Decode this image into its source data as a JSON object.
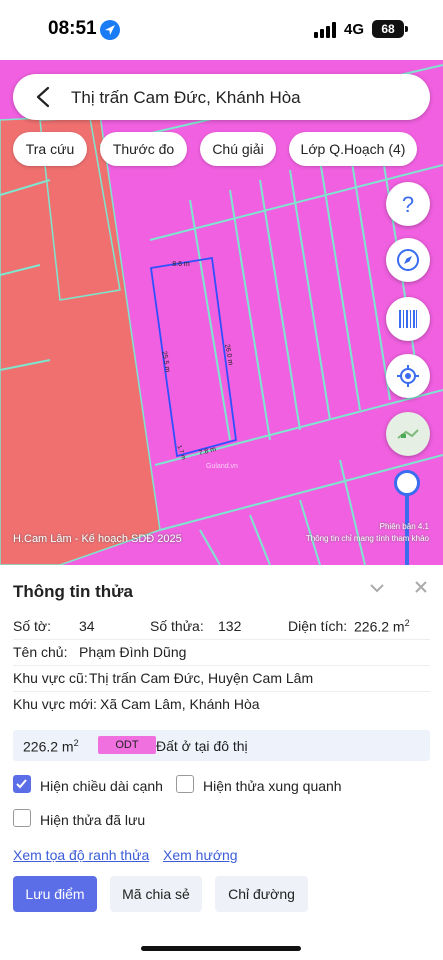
{
  "status_bar": {
    "time": "08:51",
    "network": "4G",
    "battery": "68"
  },
  "search": {
    "text": "Thị trấn Cam Đức, Khánh Hòa"
  },
  "chips": [
    {
      "label": "Tra cứu"
    },
    {
      "label": "Thước đo"
    },
    {
      "label": "Chú giải"
    },
    {
      "label": "Lớp Q.Hoạch (4)"
    }
  ],
  "fabs": {
    "help": "?",
    "compass": "compass-icon",
    "barcode": "barcode-icon",
    "locate": "locate-icon",
    "map_layer": "map-thumbnail-icon"
  },
  "map": {
    "dims": {
      "top": "8.6 m",
      "left": "25.5 m",
      "right": "26.0 m",
      "bottom": "7.8 m",
      "corner": "1.7 m"
    },
    "watermark": "Guland.vn",
    "label_left": "H.Cam Lâm - Kế hoạch SDĐ 2025",
    "label_right_1": "Phiên bản 4.1",
    "label_right_2": "Thông tin chỉ mang tính tham khảo",
    "colors": {
      "land": "#f060e0",
      "red_zone": "#f07070",
      "boundary": "#7ee6cf",
      "parcel": "#3050ff"
    }
  },
  "panel": {
    "title": "Thông tin thửa",
    "so_to_label": "Số tờ:",
    "so_to_value": "34",
    "so_thua_label": "Số thửa:",
    "so_thua_value": "132",
    "dien_tich_label": "Diện tích:",
    "dien_tich_value": "226.2 m",
    "dien_tich_sup": "2",
    "ten_chu_label": "Tên chủ:",
    "ten_chu_value": "Phạm Đình Dũng",
    "kv_cu_label": "Khu vực cũ:",
    "kv_cu_value": "Thị trấn Cam Đức, Huyện Cam Lâm",
    "kv_moi_label": "Khu vực mới:",
    "kv_moi_value": "Xã Cam Lâm, Khánh Hòa",
    "area_value": "226.2 m",
    "area_sup": "2",
    "odt": "ODT",
    "odt_desc": "Đất ở tại đô thị",
    "cb1": "Hiện chiều dài cạnh",
    "cb2": "Hiện thửa xung quanh",
    "cb3": "Hiện thửa đã lưu",
    "link1": "Xem tọa độ ranh thửa",
    "link2": "Xem hướng",
    "btn_save": "Lưu điểm",
    "btn_share": "Mã chia sẻ",
    "btn_route": "Chỉ đường"
  }
}
